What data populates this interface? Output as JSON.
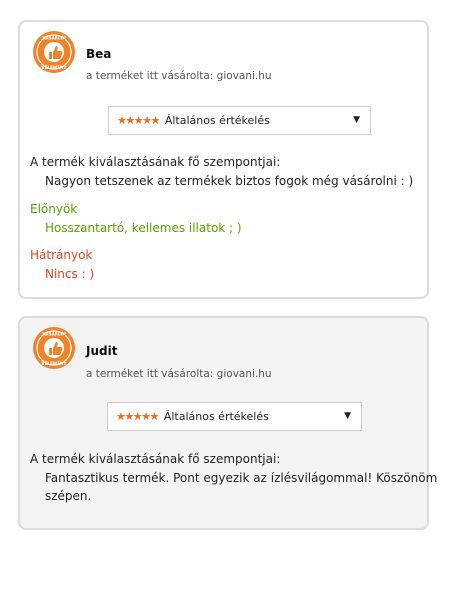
{
  "badge": {
    "text_top": "VÁSÁRLÓI",
    "text_bottom": "VÉLEMÉNY",
    "color": "#f0822a",
    "icon": "thumbs-up-icon"
  },
  "colors": {
    "stars": "#f26a1b",
    "pros": "#5aa100",
    "cons": "#e2461c",
    "card_border": "#dcdcdc",
    "card_alt_bg": "#f3f3f3"
  },
  "reviews": [
    {
      "name": "Bea",
      "purchase_note": "a terméket itt vásárolta: giovani.hu",
      "rating_stars": "★★★★★",
      "rating_count": 5,
      "rating_label": "Általános értékelés",
      "criteria_title": "A termék kiválasztásának fő szempontjai:",
      "criteria_text": "Nagyon tetszenek az termékek biztos fogok még vásárolni : )",
      "pros_title": "Előnyök",
      "pros_text": "Hosszantartó, kellemes illatok ; )",
      "cons_title": "Hátrányok",
      "cons_text": "Nincs : )"
    },
    {
      "name": "Judit",
      "purchase_note": "a terméket itt vásárolta: giovani.hu",
      "rating_stars": "★★★★★",
      "rating_count": 5,
      "rating_label": "Általános értékelés",
      "criteria_title": "A termék kiválasztásának fő szempontjai:",
      "criteria_text_line1": "Fantasztikus termék. Pont egyezik az ízlésvilágommal! Köszönöm",
      "criteria_text_line2": "szépen."
    }
  ]
}
